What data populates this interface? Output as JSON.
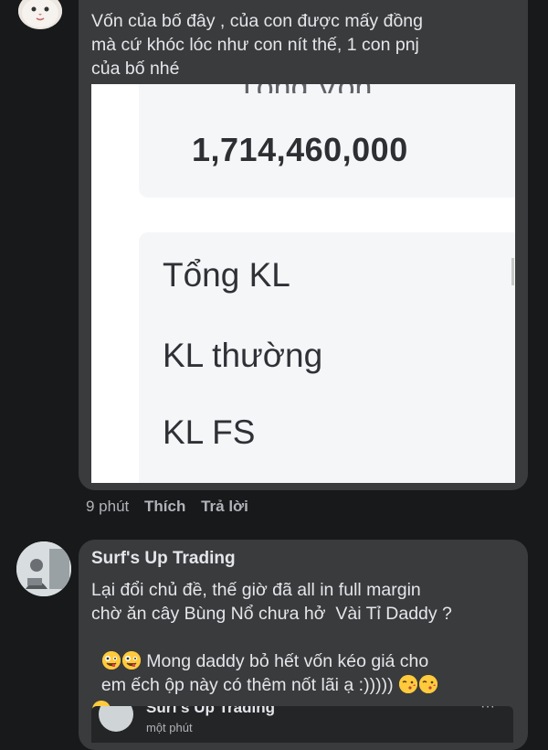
{
  "comment1": {
    "text": "Vốn của bố đây , của con được mấy đồng\nmà cứ khóc lóc như con nít thế, 1 con pnj\ncủa bố nhé",
    "screenshot": {
      "top_label": "Tổng Vốn",
      "total_value": "1,714,460,000",
      "rows": [
        "Tổng KL",
        "KL thường",
        "KL FS"
      ]
    },
    "time": "9 phút",
    "like_label": "Thích",
    "reply_label": "Trả lời"
  },
  "comment2": {
    "author": "Surf's Up Trading",
    "line1": "Lại đổi chủ đề, thế giờ đã all in full margin",
    "line2": "chờ ăn cây Bùng Nổ chưa hở  Vài Tỉ Daddy ?",
    "line3_text": " Mong daddy bỏ hết vốn kéo giá cho",
    "line4_text": "em ếch ộp này có thêm nốt lãi ạ :)))))",
    "emojis": [
      "zany-face-emoji",
      "zany-face-emoji",
      "kiss-face-emoji",
      "kiss-face-emoji",
      "kiss-face-emoji"
    ]
  },
  "quoted": {
    "author": "Surf's Up Trading",
    "time": "một phút",
    "menu": "···"
  },
  "colors": {
    "background": "#18191a",
    "bubble": "#3a3b3c",
    "text": "#e4e6eb",
    "meta": "#b0b3b8"
  }
}
